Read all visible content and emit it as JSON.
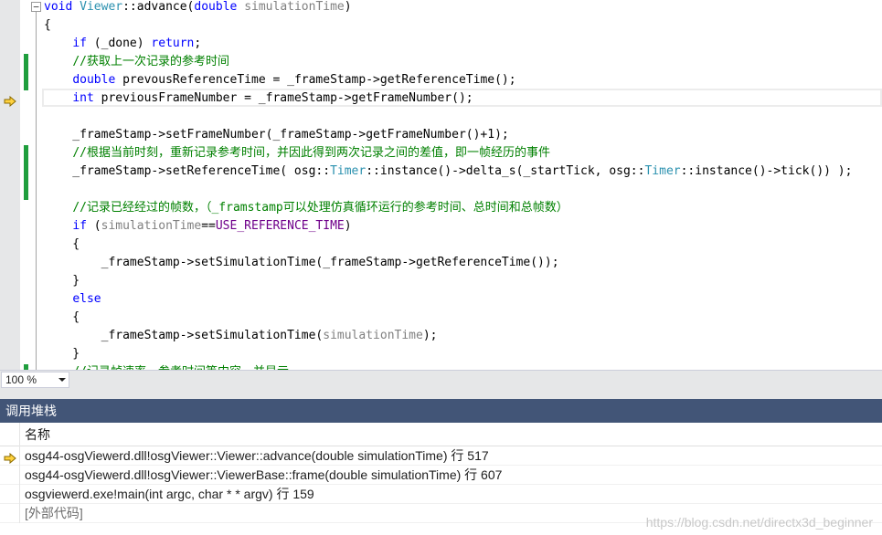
{
  "editor": {
    "lines": [
      [
        {
          "t": "void ",
          "c": "kw"
        },
        {
          "t": "Viewer",
          "c": "type"
        },
        {
          "t": "::advance("
        },
        {
          "t": "double ",
          "c": "kw"
        },
        {
          "t": "simulationTime",
          "c": "param"
        },
        {
          "t": ")"
        }
      ],
      [
        {
          "t": "{"
        }
      ],
      [
        {
          "t": "    "
        },
        {
          "t": "if",
          "c": "kw"
        },
        {
          "t": " (_done) "
        },
        {
          "t": "return",
          "c": "kw"
        },
        {
          "t": ";"
        }
      ],
      [
        {
          "t": "    "
        },
        {
          "t": "//获取上一次记录的参考时间",
          "c": "comment"
        }
      ],
      [
        {
          "t": "    "
        },
        {
          "t": "double",
          "c": "kw"
        },
        {
          "t": " prevousReferenceTime = _frameStamp->getReferenceTime();"
        }
      ],
      [
        {
          "t": "    "
        },
        {
          "t": "int",
          "c": "kw"
        },
        {
          "t": " previousFrameNumber = _frameStamp->getFrameNumber();"
        }
      ],
      [
        {
          "t": ""
        }
      ],
      [
        {
          "t": "    _frameStamp->setFrameNumber(_frameStamp->getFrameNumber()+1);"
        }
      ],
      [
        {
          "t": "    "
        },
        {
          "t": "//根据当前时刻，重新记录参考时间，并因此得到两次记录之间的差值，即一帧经历的事件",
          "c": "comment"
        }
      ],
      [
        {
          "t": "    _frameStamp->setReferenceTime( osg::"
        },
        {
          "t": "Timer",
          "c": "type"
        },
        {
          "t": "::instance()->delta_s(_startTick, osg::"
        },
        {
          "t": "Timer",
          "c": "type"
        },
        {
          "t": "::instance()->tick()) );"
        }
      ],
      [
        {
          "t": ""
        }
      ],
      [
        {
          "t": "    "
        },
        {
          "t": "//记录已经经过的帧数，（_framstamp可以处理仿真循环运行的参考时间、总时间和总帧数）",
          "c": "comment"
        }
      ],
      [
        {
          "t": "    "
        },
        {
          "t": "if",
          "c": "kw"
        },
        {
          "t": " ("
        },
        {
          "t": "simulationTime",
          "c": "param"
        },
        {
          "t": "=="
        },
        {
          "t": "USE_REFERENCE_TIME",
          "c": "macro"
        },
        {
          "t": ")"
        }
      ],
      [
        {
          "t": "    {"
        }
      ],
      [
        {
          "t": "        _frameStamp->setSimulationTime(_frameStamp->getReferenceTime());"
        }
      ],
      [
        {
          "t": "    }"
        }
      ],
      [
        {
          "t": "    "
        },
        {
          "t": "else",
          "c": "kw"
        }
      ],
      [
        {
          "t": "    {"
        }
      ],
      [
        {
          "t": "        _frameStamp->setSimulationTime("
        },
        {
          "t": "simulationTime",
          "c": "param"
        },
        {
          "t": ");"
        }
      ],
      [
        {
          "t": "    }"
        }
      ],
      [
        {
          "t": "    "
        },
        {
          "t": "//记录帧速率，参考时间等内容，并显示",
          "c": "comment"
        }
      ]
    ],
    "changed_lines": [
      3,
      4,
      8,
      9,
      10,
      20
    ],
    "instruction_pointer_line": 5,
    "collapse_glyph": "−"
  },
  "zoom": {
    "value": "100 %"
  },
  "call_stack": {
    "title": "调用堆栈",
    "column_name": "名称",
    "rows": [
      {
        "text": "osg44-osgViewerd.dll!osgViewer::Viewer::advance(double simulationTime) 行 517",
        "current": true,
        "external": false
      },
      {
        "text": "osg44-osgViewerd.dll!osgViewer::ViewerBase::frame(double simulationTime) 行 607",
        "current": false,
        "external": false
      },
      {
        "text": "osgviewerd.exe!main(int argc, char * * argv) 行 159",
        "current": false,
        "external": false
      },
      {
        "text": "[外部代码]",
        "current": false,
        "external": true
      }
    ]
  },
  "watermark": "https://blog.csdn.net/directx3d_beginner",
  "colors": {
    "keyword": "#0000ff",
    "type": "#2b91af",
    "comment": "#008000",
    "parameter": "#808080",
    "macro": "#6f008a",
    "change_bar": "#1f9e3d",
    "panel_header": "#425577",
    "arrow_fill": "#ffd23f"
  }
}
